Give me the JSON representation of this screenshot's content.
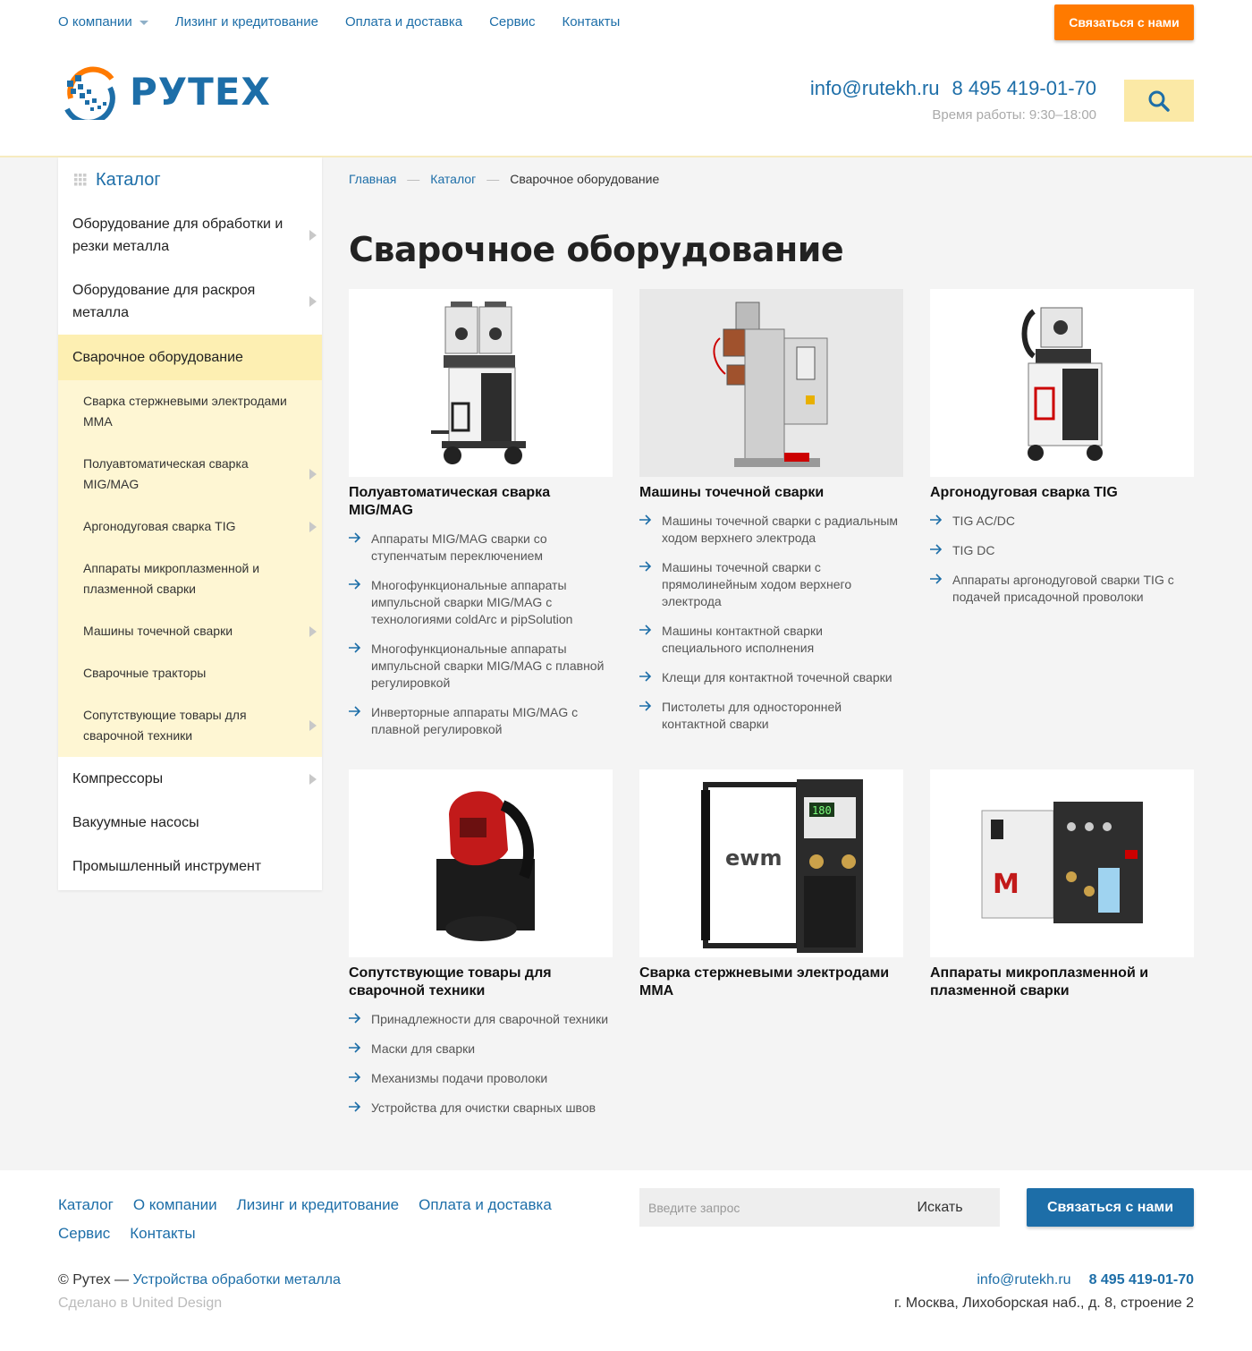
{
  "topnav": {
    "items": [
      "О компании",
      "Лизинг и кредитование",
      "Оплата и доставка",
      "Сервис",
      "Контакты"
    ],
    "contact_button": "Связаться с нами"
  },
  "logo": {
    "text": "РУТЕХ"
  },
  "header_contacts": {
    "email": "info@rutekh.ru",
    "phone": "8 495 419-01-70",
    "hours": "Время работы: 9:30–18:00"
  },
  "sidebar": {
    "title": "Каталог",
    "items": [
      {
        "label": "Оборудование для обработки и резки металла",
        "has_children": true
      },
      {
        "label": "Оборудование для раскроя металла",
        "has_children": true
      },
      {
        "label": "Сварочное оборудование",
        "active": true
      },
      {
        "label": "Компрессоры",
        "has_children": true
      },
      {
        "label": "Вакуумные насосы"
      },
      {
        "label": "Промышленный инструмент"
      }
    ],
    "subitems": [
      {
        "label": "Сварка стержневыми электродами MMA",
        "has_children": false
      },
      {
        "label": "Полуавтоматическая сварка MIG/MAG",
        "has_children": true
      },
      {
        "label": "Аргонодуговая сварка TIG",
        "has_children": true
      },
      {
        "label": "Аппараты микроплазменной и плазменной сварки",
        "has_children": false
      },
      {
        "label": "Машины точечной сварки",
        "has_children": true
      },
      {
        "label": "Сварочные тракторы",
        "has_children": false
      },
      {
        "label": "Сопутствующие товары для сварочной техники",
        "has_children": true
      }
    ]
  },
  "breadcrumb": {
    "home": "Главная",
    "catalog": "Каталог",
    "current": "Сварочное оборудование",
    "sep": "—"
  },
  "page_title": "Сварочное оборудование",
  "cards": [
    {
      "title": "Полуавтоматическая сварка MIG/MAG",
      "links": [
        "Аппараты MIG/MAG сварки со ступенчатым переключением",
        "Многофункциональные аппараты импульсной сварки MIG/MAG с технологиями coldArc и pipSolution",
        "Многофункциональные аппараты импульсной сварки MIG/MAG с плавной регулировкой",
        "Инверторные аппараты MIG/MAG с плавной регулировкой"
      ]
    },
    {
      "title": "Машины точечной сварки",
      "links": [
        "Машины точечной сварки с радиальным ходом верхнего электрода",
        "Машины точечной сварки с прямолинейным ходом верхнего электрода",
        "Машины контактной сварки специального исполнения",
        "Клещи для контактной точечной сварки",
        "Пистолеты для односторонней контактной сварки"
      ]
    },
    {
      "title": "Аргонодуговая сварка TIG",
      "links": [
        "TIG AC/DC",
        "TIG DC",
        "Аппараты аргонодуговой сварки TIG с подачей присадочной проволоки"
      ]
    },
    {
      "title": "Сопутствующие товары для сварочной техники",
      "links": [
        "Принадлежности для сварочной техники",
        "Маски для сварки",
        "Механизмы подачи проволоки",
        "Устройства для очистки сварных швов"
      ]
    },
    {
      "title": "Сварка стержневыми электродами MMA",
      "links": []
    },
    {
      "title": "Аппараты микроплазменной и плазменной сварки",
      "links": []
    }
  ],
  "product_marks": {
    "ewm": "ewm",
    "display": "180",
    "m": "M"
  },
  "footer": {
    "nav": [
      "Каталог",
      "О компании",
      "Лизинг и кредитование",
      "Оплата и доставка",
      "Сервис",
      "Контакты"
    ],
    "search_placeholder": "Введите запрос",
    "search_button": "Искать",
    "contact_button": "Связаться с нами",
    "copyright_prefix": "© Рутех — ",
    "copyright_link": "Устройства обработки металла",
    "made_by": "Сделано в United Design",
    "email": "info@rutekh.ru",
    "phone": "8 495 419-01-70",
    "address": "г. Москва, Лихоборская наб., д. 8, строение 2"
  },
  "colors": {
    "brand_blue": "#1d6ea8",
    "orange": "#ff7a00",
    "yellow": "#fbe9a6",
    "active_bg": "#fdefb2",
    "sub_bg": "#fef6d3"
  },
  "icons": {
    "search": "search-icon",
    "grid": "grid-icon",
    "arrow": "arrow-right-icon",
    "chevron": "chevron-right-icon"
  }
}
